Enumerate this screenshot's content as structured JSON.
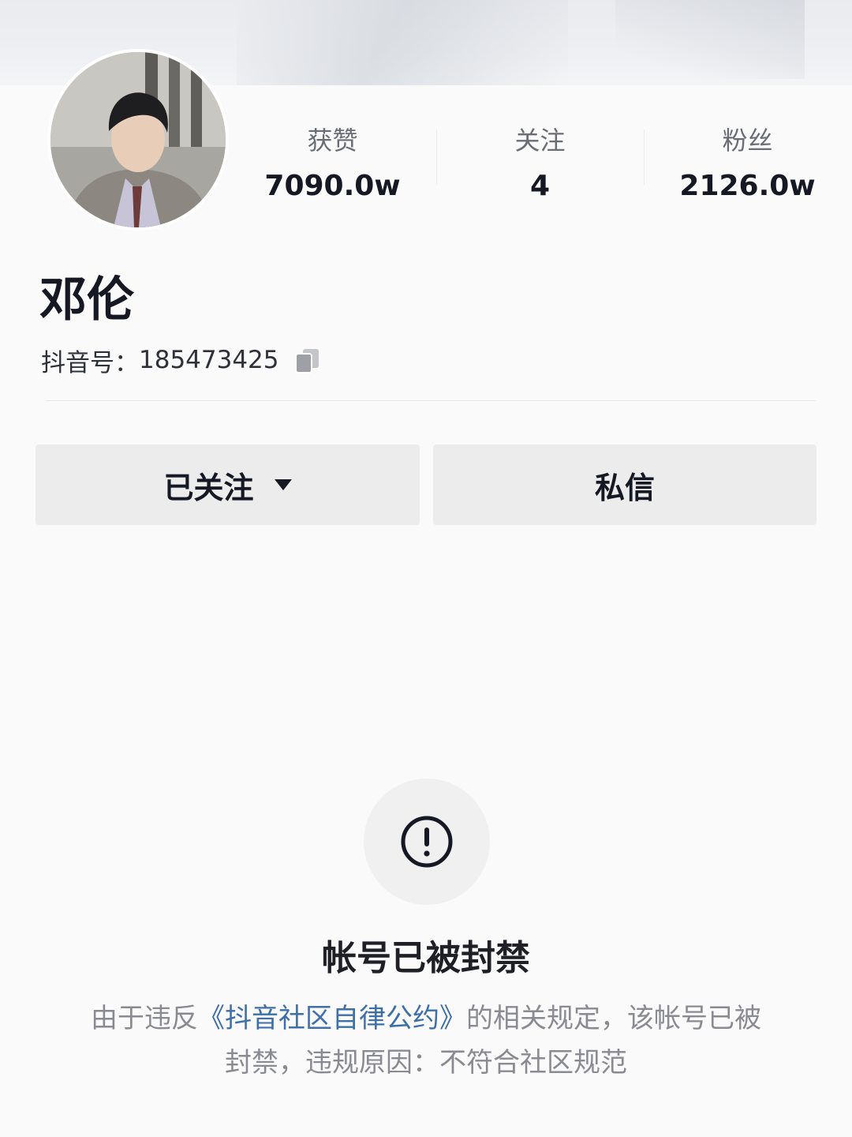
{
  "profile": {
    "name": "邓伦",
    "id_label": "抖音号：",
    "id_value": "185473425"
  },
  "stats": [
    {
      "label": "获赞",
      "value": "7090.0w"
    },
    {
      "label": "关注",
      "value": "4"
    },
    {
      "label": "粉丝",
      "value": "2126.0w"
    }
  ],
  "actions": {
    "follow_label": "已关注",
    "message_label": "私信"
  },
  "notice": {
    "title": "帐号已被封禁",
    "desc_before": "由于违反",
    "desc_link": "《抖音社区自律公约》",
    "desc_after": "的相关规定，该帐号已被封禁，违规原因：不符合社区规范"
  },
  "icons": {
    "copy": "copy-icon",
    "caret": "caret-down-icon",
    "warning": "exclamation-circle-icon"
  },
  "colors": {
    "link": "#3d6fa8",
    "button_bg": "#ececec",
    "muted_text": "#8a8b91"
  }
}
